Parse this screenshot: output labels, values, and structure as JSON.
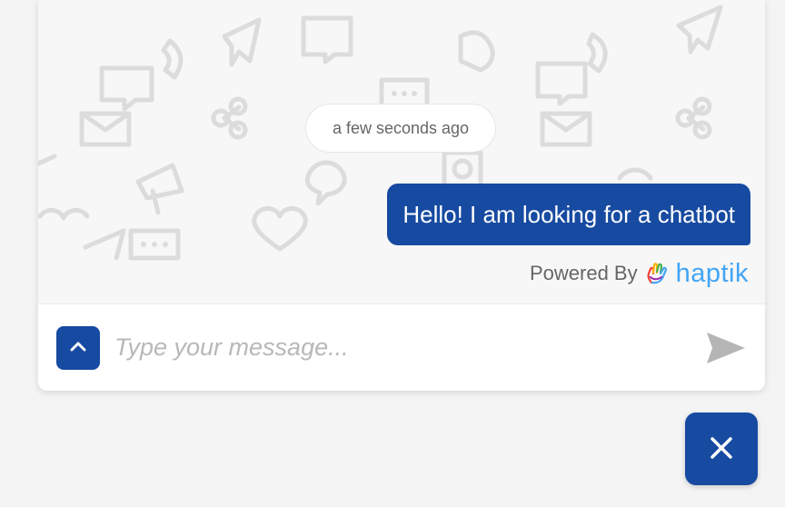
{
  "chat": {
    "timestamp": "a few seconds ago",
    "messages": [
      {
        "sender": "user",
        "text": "Hello! I am looking for a chatbot"
      }
    ],
    "powered_by": {
      "label": "Powered By",
      "brand": "haptik"
    }
  },
  "composer": {
    "placeholder": "Type your message..."
  },
  "icons": {
    "expand": "chevron-up-icon",
    "send": "send-icon",
    "close": "close-icon",
    "brand": "haptik-hand-icon"
  },
  "colors": {
    "primary": "#174aa1",
    "brand_blue": "#42a5f5",
    "background": "#f4f4f4",
    "chat_background": "#f7f7f7",
    "pattern": "#d9d9d9"
  }
}
